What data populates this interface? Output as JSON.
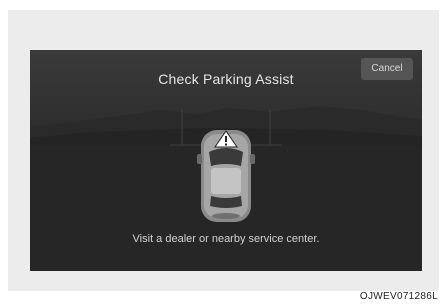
{
  "dialog": {
    "title": "Check Parking Assist",
    "cancel_label": "Cancel",
    "message": "Visit a dealer or nearby service center."
  },
  "caption": "OJWEV071286L",
  "colors": {
    "screen_bg": "#2e2e2e",
    "text": "#e6e6e6",
    "warning_sensor": "#ffffff"
  },
  "icons": {
    "vehicle": "car-top-view-icon",
    "warning": "warning-triangle-icon"
  }
}
